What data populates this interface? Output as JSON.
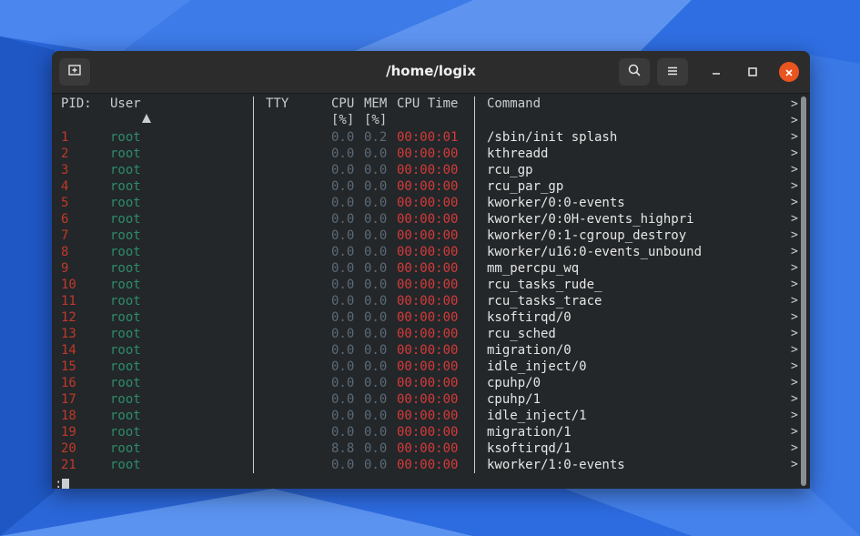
{
  "window": {
    "title": "/home/logix"
  },
  "columns": {
    "pid": "PID:",
    "user": "User",
    "tty": "TTY",
    "cpu_top": "CPU",
    "cpu_bottom": "[%]",
    "mem_top": "MEM",
    "mem_bottom": "[%]",
    "cputime": "CPU Time",
    "command": "Command"
  },
  "processes": [
    {
      "pid": "1",
      "user": "root",
      "cpu": "0.0",
      "mem": "0.2",
      "time": "00:00:01",
      "command": "/sbin/init splash"
    },
    {
      "pid": "2",
      "user": "root",
      "cpu": "0.0",
      "mem": "0.0",
      "time": "00:00:00",
      "command": "kthreadd"
    },
    {
      "pid": "3",
      "user": "root",
      "cpu": "0.0",
      "mem": "0.0",
      "time": "00:00:00",
      "command": "rcu_gp"
    },
    {
      "pid": "4",
      "user": "root",
      "cpu": "0.0",
      "mem": "0.0",
      "time": "00:00:00",
      "command": "rcu_par_gp"
    },
    {
      "pid": "5",
      "user": "root",
      "cpu": "0.0",
      "mem": "0.0",
      "time": "00:00:00",
      "command": "kworker/0:0-events"
    },
    {
      "pid": "6",
      "user": "root",
      "cpu": "0.0",
      "mem": "0.0",
      "time": "00:00:00",
      "command": "kworker/0:0H-events_highpri"
    },
    {
      "pid": "7",
      "user": "root",
      "cpu": "0.0",
      "mem": "0.0",
      "time": "00:00:00",
      "command": "kworker/0:1-cgroup_destroy"
    },
    {
      "pid": "8",
      "user": "root",
      "cpu": "0.0",
      "mem": "0.0",
      "time": "00:00:00",
      "command": "kworker/u16:0-events_unbound"
    },
    {
      "pid": "9",
      "user": "root",
      "cpu": "0.0",
      "mem": "0.0",
      "time": "00:00:00",
      "command": "mm_percpu_wq"
    },
    {
      "pid": "10",
      "user": "root",
      "cpu": "0.0",
      "mem": "0.0",
      "time": "00:00:00",
      "command": "rcu_tasks_rude_"
    },
    {
      "pid": "11",
      "user": "root",
      "cpu": "0.0",
      "mem": "0.0",
      "time": "00:00:00",
      "command": "rcu_tasks_trace"
    },
    {
      "pid": "12",
      "user": "root",
      "cpu": "0.0",
      "mem": "0.0",
      "time": "00:00:00",
      "command": "ksoftirqd/0"
    },
    {
      "pid": "13",
      "user": "root",
      "cpu": "0.0",
      "mem": "0.0",
      "time": "00:00:00",
      "command": "rcu_sched"
    },
    {
      "pid": "14",
      "user": "root",
      "cpu": "0.0",
      "mem": "0.0",
      "time": "00:00:00",
      "command": "migration/0"
    },
    {
      "pid": "15",
      "user": "root",
      "cpu": "0.0",
      "mem": "0.0",
      "time": "00:00:00",
      "command": "idle_inject/0"
    },
    {
      "pid": "16",
      "user": "root",
      "cpu": "0.0",
      "mem": "0.0",
      "time": "00:00:00",
      "command": "cpuhp/0"
    },
    {
      "pid": "17",
      "user": "root",
      "cpu": "0.0",
      "mem": "0.0",
      "time": "00:00:00",
      "command": "cpuhp/1"
    },
    {
      "pid": "18",
      "user": "root",
      "cpu": "0.0",
      "mem": "0.0",
      "time": "00:00:00",
      "command": "idle_inject/1"
    },
    {
      "pid": "19",
      "user": "root",
      "cpu": "0.0",
      "mem": "0.0",
      "time": "00:00:00",
      "command": "migration/1"
    },
    {
      "pid": "20",
      "user": "root",
      "cpu": "8.8",
      "mem": "0.0",
      "time": "00:00:00",
      "command": "ksoftirqd/1"
    },
    {
      "pid": "21",
      "user": "root",
      "cpu": "0.0",
      "mem": "0.0",
      "time": "00:00:00",
      "command": "kworker/1:0-events"
    }
  ],
  "prompt": ":",
  "colors": {
    "desktop": "#2f6fe0",
    "pid": "#c0392b",
    "user": "#2e8b6a",
    "time": "#d63a3a",
    "close": "#e95420"
  },
  "icons": {
    "new_tab": "new-tab-icon",
    "search": "search-icon",
    "menu": "hamburger-menu-icon",
    "minimize": "minimize-icon",
    "maximize": "maximize-icon",
    "close": "close-icon",
    "sort": "sort-ascending-icon"
  }
}
